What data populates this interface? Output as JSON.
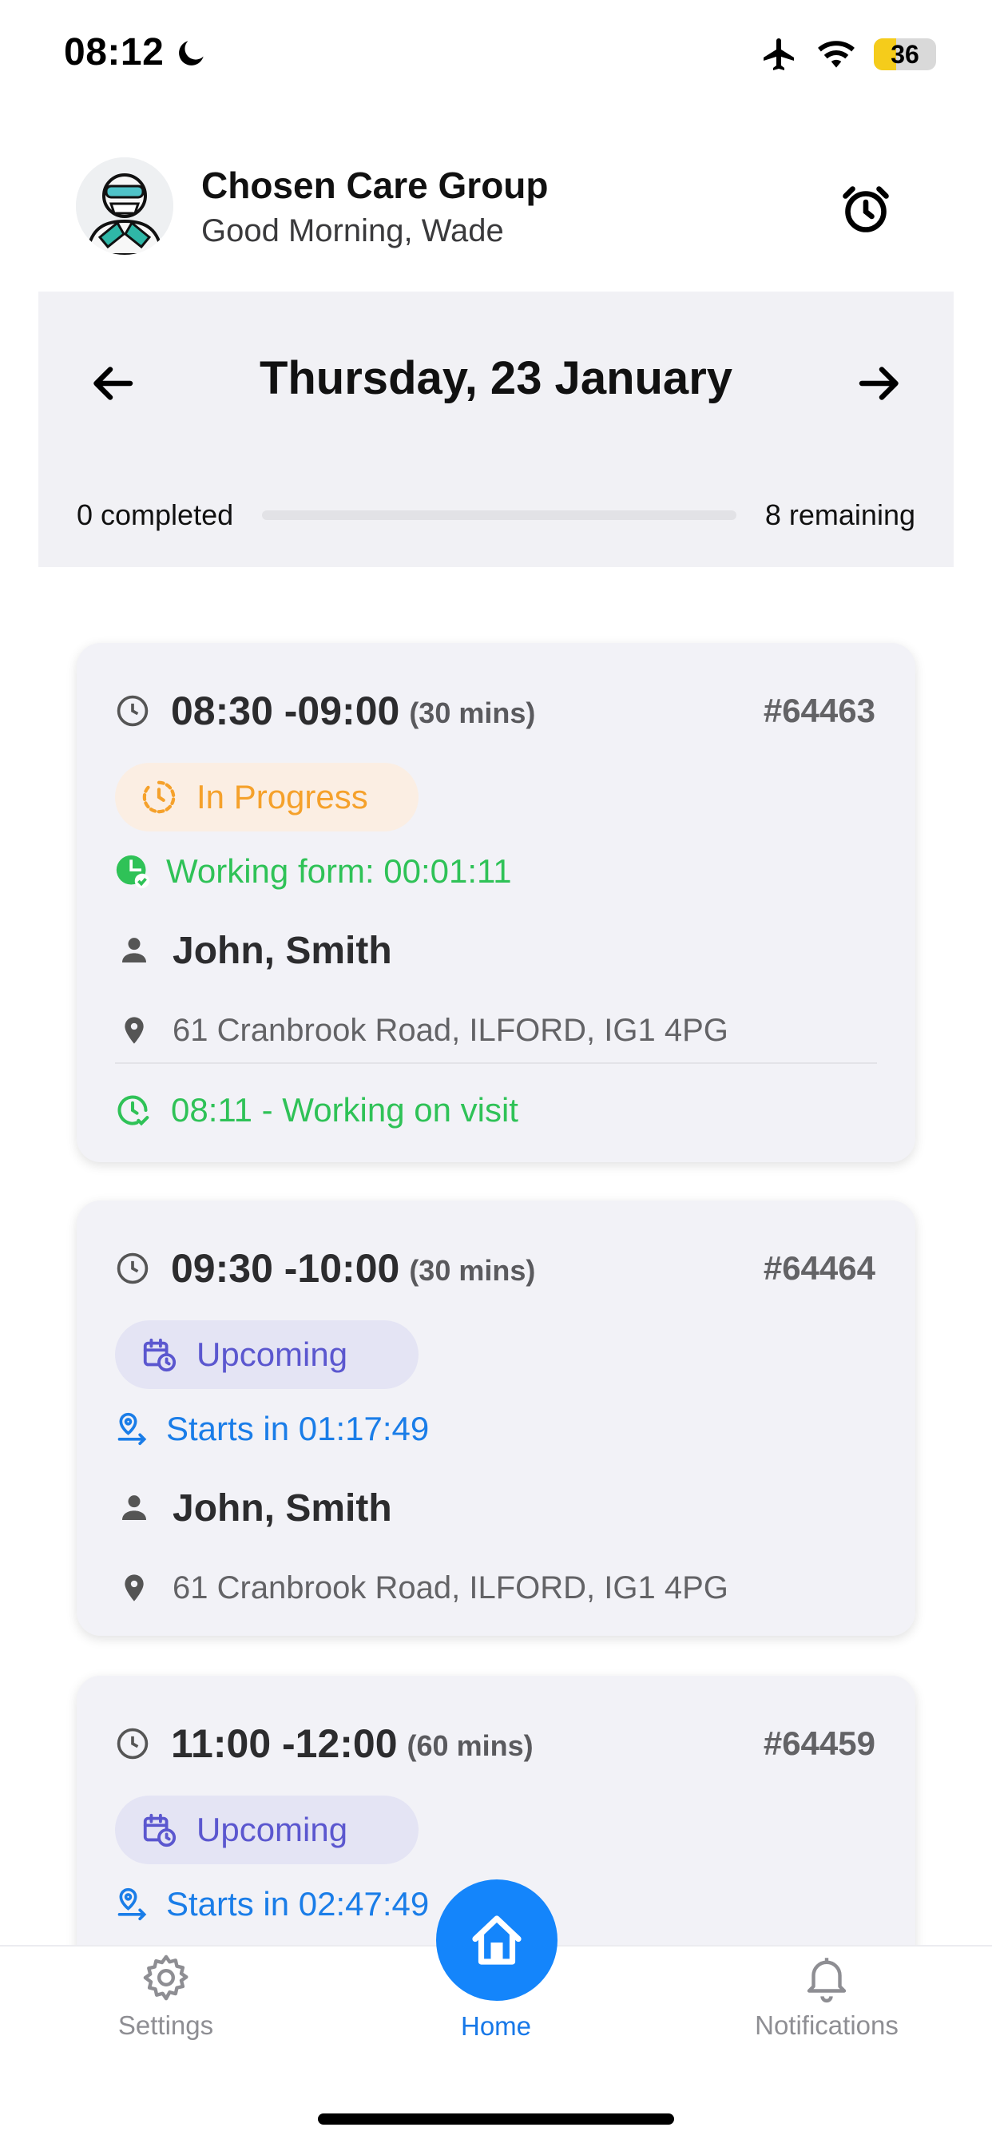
{
  "status_bar": {
    "time": "08:12",
    "battery": "36",
    "battery_level": 0.36,
    "icons": [
      "moon-icon",
      "airplane-icon",
      "wifi-icon",
      "battery-icon"
    ]
  },
  "header": {
    "org_name": "Chosen Care Group",
    "greeting": "Good Morning, Wade",
    "alarm_icon": "alarm-clock-icon"
  },
  "date_nav": {
    "date": "Thursday, 23 January",
    "completed": "0 completed",
    "remaining": "8 remaining",
    "progress": 0
  },
  "visits": [
    {
      "time": "08:30 -09:00",
      "duration": "(30 mins)",
      "id": "#64463",
      "status": "In Progress",
      "sub_text": "Working form: 00:01:11",
      "client": "John, Smith",
      "address": "61 Cranbrook Road, ILFORD, IG1 4PG",
      "log": "08:11 - Working on visit"
    },
    {
      "time": "09:30 -10:00",
      "duration": "(30 mins)",
      "id": "#64464",
      "status": "Upcoming",
      "sub_text": "Starts in 01:17:49",
      "client": "John, Smith",
      "address": "61 Cranbrook Road, ILFORD, IG1 4PG"
    },
    {
      "time": "11:00 -12:00",
      "duration": "(60 mins)",
      "id": "#64459",
      "status": "Upcoming",
      "sub_text": "Starts in 02:47:49"
    }
  ],
  "colors": {
    "accent": "#1485fb",
    "in_progress": "#f5a12b",
    "in_progress_bg": "#fbeee3",
    "upcoming": "#5b57cf",
    "upcoming_bg": "#e4e4f4",
    "success": "#2fc257",
    "link": "#1a7de8"
  },
  "tabs": {
    "settings": "Settings",
    "home": "Home",
    "notifications": "Notifications"
  }
}
